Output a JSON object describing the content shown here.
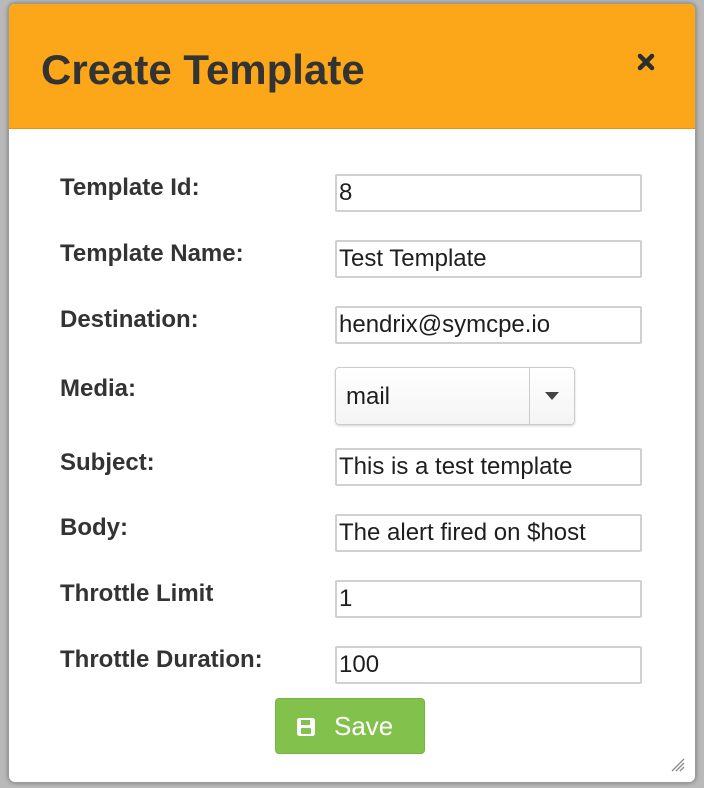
{
  "dialog": {
    "title": "Create Template",
    "close_icon": "close-icon",
    "accent_color": "#fba719"
  },
  "form": {
    "template_id": {
      "label": "Template Id:",
      "value": "8"
    },
    "template_name": {
      "label": "Template Name:",
      "value": "Test Template"
    },
    "destination": {
      "label": "Destination:",
      "value": "hendrix@symcpe.io"
    },
    "media": {
      "label": "Media:",
      "selected": "mail"
    },
    "subject": {
      "label": "Subject:",
      "value": "This is a test template"
    },
    "body": {
      "label": "Body:",
      "value": "The alert fired on $host"
    },
    "throttle_limit": {
      "label": "Throttle Limit",
      "value": "1"
    },
    "throttle_duration": {
      "label": "Throttle Duration:",
      "value": "100"
    }
  },
  "actions": {
    "save_label": "Save",
    "save_icon": "floppy-disk-icon",
    "save_color": "#82c14c"
  }
}
